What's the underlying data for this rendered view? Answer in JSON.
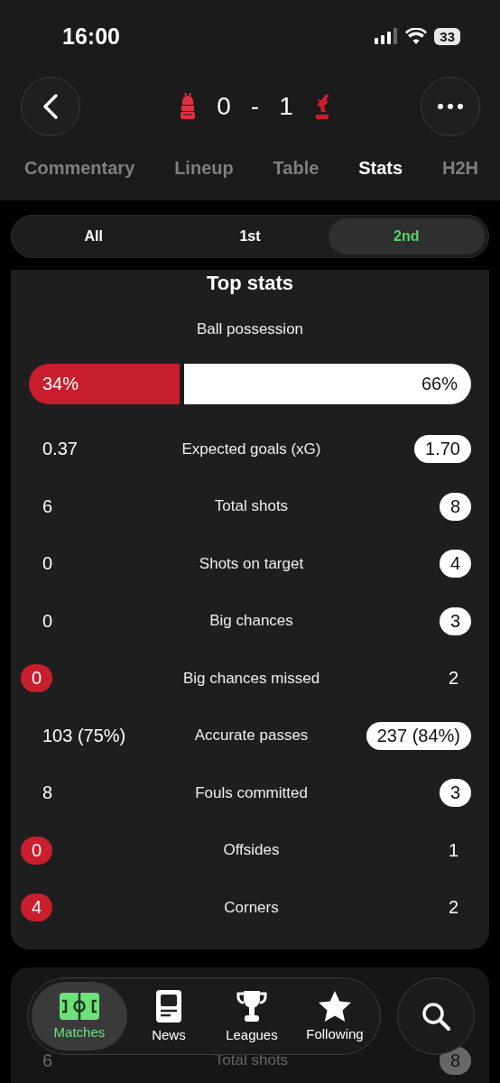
{
  "status_bar": {
    "time": "16:00",
    "battery": "33"
  },
  "header": {
    "home_score": "0",
    "separator": "-",
    "away_score": "1"
  },
  "tabs": [
    {
      "label": "Commentary",
      "selected": false
    },
    {
      "label": "Lineup",
      "selected": false
    },
    {
      "label": "Table",
      "selected": false
    },
    {
      "label": "Stats",
      "selected": true
    },
    {
      "label": "H2H",
      "selected": false
    }
  ],
  "periods": [
    {
      "label": "All",
      "selected": false
    },
    {
      "label": "1st",
      "selected": false
    },
    {
      "label": "2nd",
      "selected": true
    }
  ],
  "card": {
    "title": "Top stats",
    "possession": {
      "label": "Ball possession",
      "home": "34%",
      "away": "66%",
      "level": 0.34
    },
    "rows": [
      {
        "home": "0.37",
        "label": "Expected goals (xG)",
        "away": "1.70",
        "home_highlighted": false,
        "away_highlighted": true
      },
      {
        "home": "6",
        "label": "Total shots",
        "away": "8",
        "home_highlighted": false,
        "away_highlighted": true
      },
      {
        "home": "0",
        "label": "Shots on target",
        "away": "4",
        "home_highlighted": false,
        "away_highlighted": true
      },
      {
        "home": "0",
        "label": "Big chances",
        "away": "3",
        "home_highlighted": false,
        "away_highlighted": true
      },
      {
        "home": "0",
        "label": "Big chances missed",
        "away": "2",
        "home_highlighted": true,
        "away_highlighted": false
      },
      {
        "home": "103 (75%)",
        "label": "Accurate passes",
        "away": "237 (84%)",
        "home_highlighted": false,
        "away_highlighted": true
      },
      {
        "home": "8",
        "label": "Fouls committed",
        "away": "3",
        "home_highlighted": false,
        "away_highlighted": true
      },
      {
        "home": "0",
        "label": "Offsides",
        "away": "1",
        "home_highlighted": true,
        "away_highlighted": false
      },
      {
        "home": "4",
        "label": "Corners",
        "away": "2",
        "home_highlighted": true,
        "away_highlighted": false
      }
    ]
  },
  "next_card": {
    "rows": [
      {
        "home": "6",
        "label": "Total shots",
        "away": "8",
        "home_highlighted": false,
        "away_highlighted": true
      }
    ]
  },
  "nav": [
    {
      "label": "Matches",
      "selected": true,
      "kind": "pitch"
    },
    {
      "label": "News",
      "selected": false,
      "kind": "news"
    },
    {
      "label": "Leagues",
      "selected": false,
      "kind": "trophy"
    },
    {
      "label": "Following",
      "selected": false,
      "kind": "star"
    }
  ]
}
